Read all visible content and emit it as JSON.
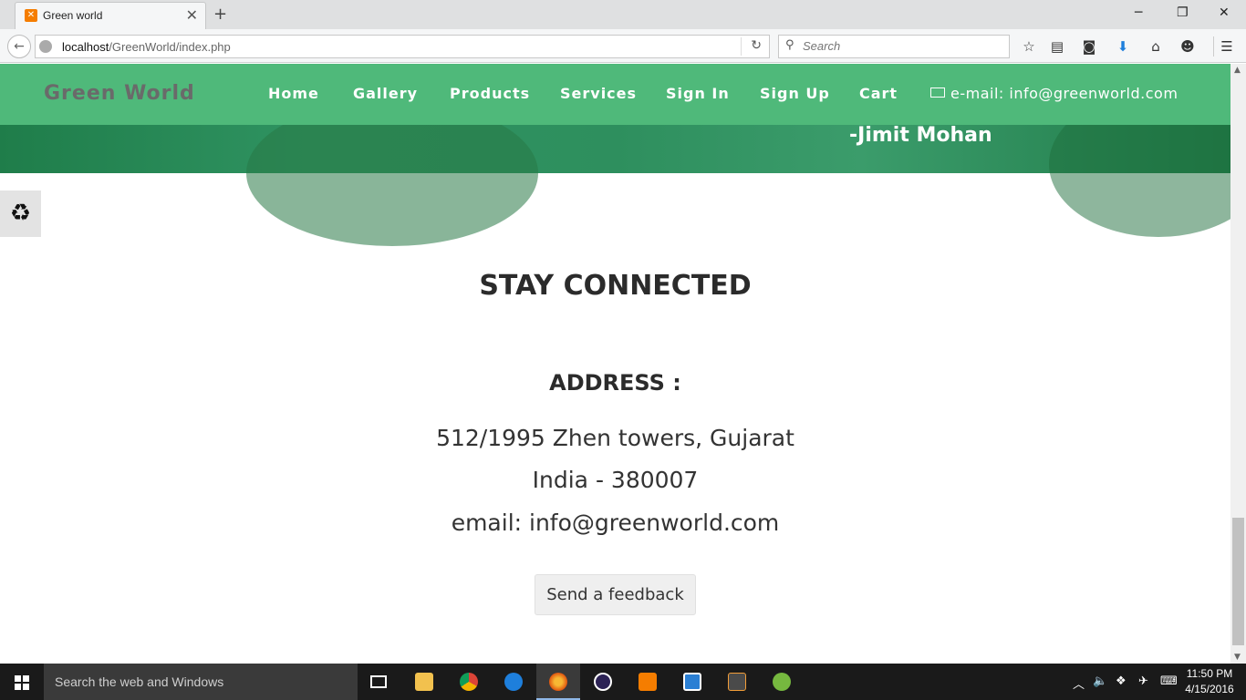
{
  "browser": {
    "tab_title": "Green world",
    "url_host": "localhost",
    "url_path": "/GreenWorld/index.php",
    "search_placeholder": "Search"
  },
  "site": {
    "brand": "Green World",
    "menu": [
      "Home",
      "Gallery",
      "Products",
      "Services",
      "Sign In",
      "Sign Up",
      "Cart"
    ],
    "email_link": "e-mail: info@greenworld.com",
    "hero_quote_author": "-Jimit Mohan"
  },
  "contact": {
    "heading": "STAY CONNECTED",
    "address_heading": "ADDRESS :",
    "address_line1": "512/1995 Zhen towers, Gujarat",
    "address_line2": "India - 380007",
    "email_line": "email: info@greenworld.com",
    "feedback_button": "Send a feedback"
  },
  "taskbar": {
    "search_placeholder": "Search the web and Windows",
    "time": "11:50 PM",
    "date": "4/15/2016"
  },
  "colors": {
    "nav_green": "#4fb97a",
    "hero_green": "#2e8f5e"
  }
}
